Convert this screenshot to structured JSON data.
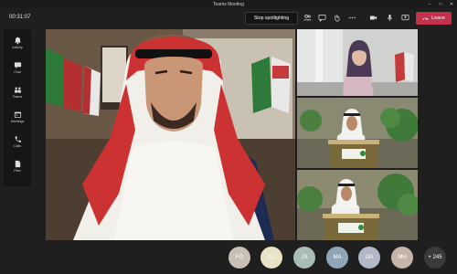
{
  "window": {
    "title": "Teams Meeting"
  },
  "call": {
    "timer": "00:31:07",
    "spotlight_button": "Stop spotlighting",
    "leave_button": "Leave"
  },
  "rail": [
    {
      "label": "Activity",
      "icon": "bell-icon"
    },
    {
      "label": "Chat",
      "icon": "chat-icon"
    },
    {
      "label": "Teams",
      "icon": "teams-icon"
    },
    {
      "label": "Meetings",
      "icon": "calendar-icon"
    },
    {
      "label": "Calls",
      "icon": "phone-icon"
    },
    {
      "label": "Files",
      "icon": "files-icon"
    }
  ],
  "participants": [
    {
      "initials": "FO",
      "color": "#c8c0b4"
    },
    {
      "initials": "CJ",
      "color": "#e8e2c6"
    },
    {
      "initials": "JS",
      "color": "#a9bdb8"
    },
    {
      "initials": "MA",
      "color": "#8fa6b8"
    },
    {
      "initials": "OA",
      "color": "#b1b8c8"
    },
    {
      "initials": "MH",
      "color": "#c6b4a8"
    }
  ],
  "more_participants": "+ 245",
  "colors": {
    "leave": "#c4314b",
    "background": "#1f1f1f"
  }
}
